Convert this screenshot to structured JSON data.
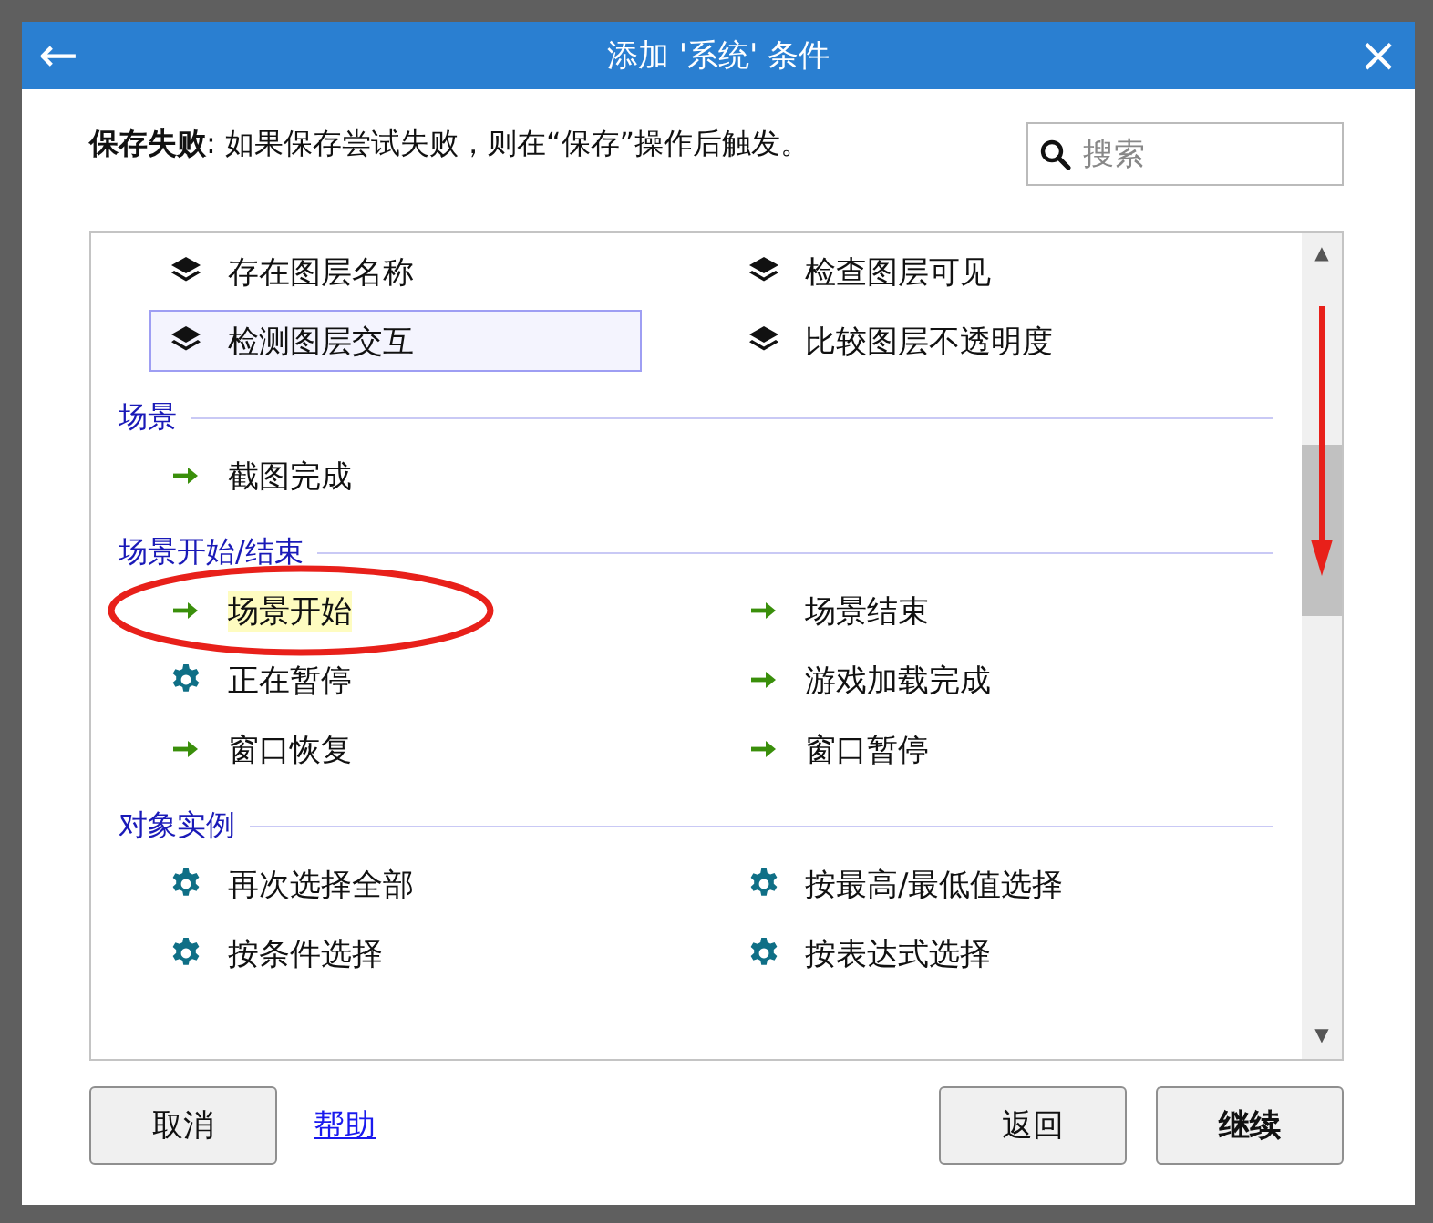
{
  "window": {
    "title": "添加 '系统' 条件",
    "back": "←",
    "close": "×"
  },
  "description": "**保存失败**: 如果保存尝试失败，则在“保存”操作后触发。",
  "search": {
    "placeholder": "搜索"
  },
  "list": {
    "scroll_arrow": true,
    "up": "▲",
    "down": "▼",
    "groups": [
      {
        "items": [
          {
            "kind": "layers",
            "label": "存在图层名称",
            "selected": false,
            "highlighted": false,
            "circled": false
          },
          {
            "kind": "layers",
            "label": "检查图层可见",
            "selected": false,
            "highlighted": false,
            "circled": false
          },
          {
            "kind": "layers",
            "label": "检测图层交互",
            "selected": true,
            "highlighted": false,
            "circled": false
          },
          {
            "kind": "layers",
            "label": "比较图层不透明度",
            "selected": false,
            "highlighted": false,
            "circled": false
          }
        ]
      },
      {
        "title": "场景",
        "items": [
          {
            "kind": "arrow",
            "label": "截图完成",
            "selected": false,
            "highlighted": false,
            "circled": false
          }
        ]
      },
      {
        "title": "场景开始/结束",
        "items": [
          {
            "kind": "arrow",
            "label": "场景开始",
            "selected": false,
            "highlighted": true,
            "circled": true
          },
          {
            "kind": "arrow",
            "label": "场景结束",
            "selected": false,
            "highlighted": false,
            "circled": false
          },
          {
            "kind": "gear",
            "label": "正在暂停",
            "selected": false,
            "highlighted": false,
            "circled": false
          },
          {
            "kind": "arrow",
            "label": "游戏加载完成",
            "selected": false,
            "highlighted": false,
            "circled": false
          },
          {
            "kind": "arrow",
            "label": "窗口恢复",
            "selected": false,
            "highlighted": false,
            "circled": false
          },
          {
            "kind": "arrow",
            "label": "窗口暂停",
            "selected": false,
            "highlighted": false,
            "circled": false
          }
        ]
      },
      {
        "title": "对象实例",
        "items": [
          {
            "kind": "gear",
            "label": "再次选择全部",
            "selected": false,
            "highlighted": false,
            "circled": false
          },
          {
            "kind": "gear",
            "label": "按最高/最低值选择",
            "selected": false,
            "highlighted": false,
            "circled": false
          },
          {
            "kind": "gear",
            "label": "按条件选择",
            "selected": false,
            "highlighted": false,
            "circled": false
          },
          {
            "kind": "gear",
            "label": "按表达式选择",
            "selected": false,
            "highlighted": false,
            "circled": false
          }
        ]
      }
    ]
  },
  "buttons": {
    "cancel": "取消",
    "help": "帮助",
    "back": "返回",
    "continue": "继续"
  }
}
